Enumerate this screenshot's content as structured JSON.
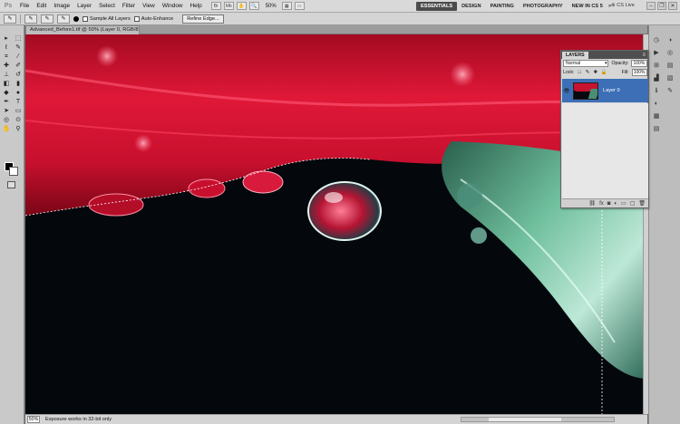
{
  "app": {
    "logo": "Ps"
  },
  "menu": [
    "File",
    "Edit",
    "Image",
    "Layer",
    "Select",
    "Filter",
    "View",
    "Window",
    "Help"
  ],
  "menubar_zoom": "50%",
  "workspaces": {
    "items": [
      "ESSENTIALS",
      "DESIGN",
      "PAINTING",
      "PHOTOGRAPHY",
      "NEW IN CS 5"
    ],
    "more": "»",
    "cslive": "CS Live"
  },
  "options": {
    "sample_all_layers": "Sample All Layers",
    "auto_enhance": "Auto-Enhance",
    "refine_edges": "Refine Edge..."
  },
  "document": {
    "tab_title": "Advanced_Before1.tif @ 50% (Layer 0, RGB/8) *"
  },
  "status": {
    "zoom": "50%",
    "message": "Exposure works in 32-bit only"
  },
  "layers_panel": {
    "tab": "LAYERS",
    "blend_mode": "Normal",
    "opacity_label": "Opacity:",
    "opacity": "100%",
    "lock_label": "Lock:",
    "fill_label": "Fill:",
    "fill": "100%",
    "layer_name": "Layer 0"
  },
  "colors": {
    "accent": "#3d6fb6",
    "petal": "#c8102e",
    "leaf": "#4fa68a"
  }
}
